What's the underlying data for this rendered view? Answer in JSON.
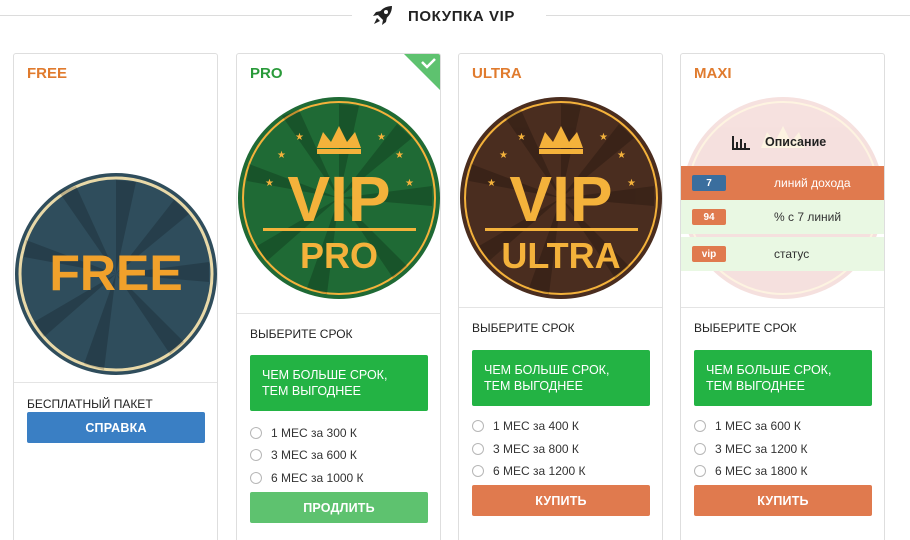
{
  "header": {
    "title": "ПОКУПКА VIP",
    "icon": "rocket-icon"
  },
  "colors": {
    "orange": "#e07b2e",
    "green": "#23b344",
    "blue": "#3a7fc4",
    "button_orange": "#e07a4e",
    "button_lightgreen": "#5ec26f",
    "dark_green": "#1f6a35",
    "dark_brown": "#4a2d1f",
    "dark_slate": "#2f4d5c",
    "gold": "#f4b23b"
  },
  "cards": [
    {
      "name": "FREE",
      "badge": {
        "main": "FREE"
      },
      "subtitle": "БЕСПЛАТНЫЙ ПАКЕТ",
      "button": "СПРАВКА"
    },
    {
      "name": "PRO",
      "selected": true,
      "badge": {
        "main": "VIP",
        "sub": "PRO"
      },
      "period_label": "ВЫБЕРИТЕ СРОК",
      "promo": [
        "ЧЕМ БОЛЬШЕ СРОК,",
        "ТЕМ ВЫГОДНЕЕ"
      ],
      "options": [
        "1 МЕС за 300 К",
        "3 МЕС за 600 К",
        "6 МЕС за 1000 К"
      ],
      "button": "ПРОДЛИТЬ"
    },
    {
      "name": "ULTRA",
      "badge": {
        "main": "VIP",
        "sub": "ULTRA"
      },
      "period_label": "ВЫБЕРИТЕ СРОК",
      "promo": [
        "ЧЕМ БОЛЬШЕ СРОК,",
        "ТЕМ ВЫГОДНЕЕ"
      ],
      "options": [
        "1 МЕС за 400 К",
        "3 МЕС за 800 К",
        "6 МЕС за 1200 К"
      ],
      "button": "КУПИТЬ"
    },
    {
      "name": "MAXI",
      "description": {
        "header": "Описание",
        "rows": [
          {
            "value": "7",
            "text": "линий дохода"
          },
          {
            "value": "94",
            "text": "% с 7 линий"
          },
          {
            "value": "vip",
            "text": "статус"
          }
        ]
      },
      "period_label": "ВЫБЕРИТЕ СРОК",
      "promo": [
        "ЧЕМ БОЛЬШЕ СРОК,",
        "ТЕМ ВЫГОДНЕЕ"
      ],
      "options": [
        "1 МЕС за 600 К",
        "3 МЕС за 1200 К",
        "6 МЕС за 1800 К"
      ],
      "button": "КУПИТЬ"
    }
  ]
}
